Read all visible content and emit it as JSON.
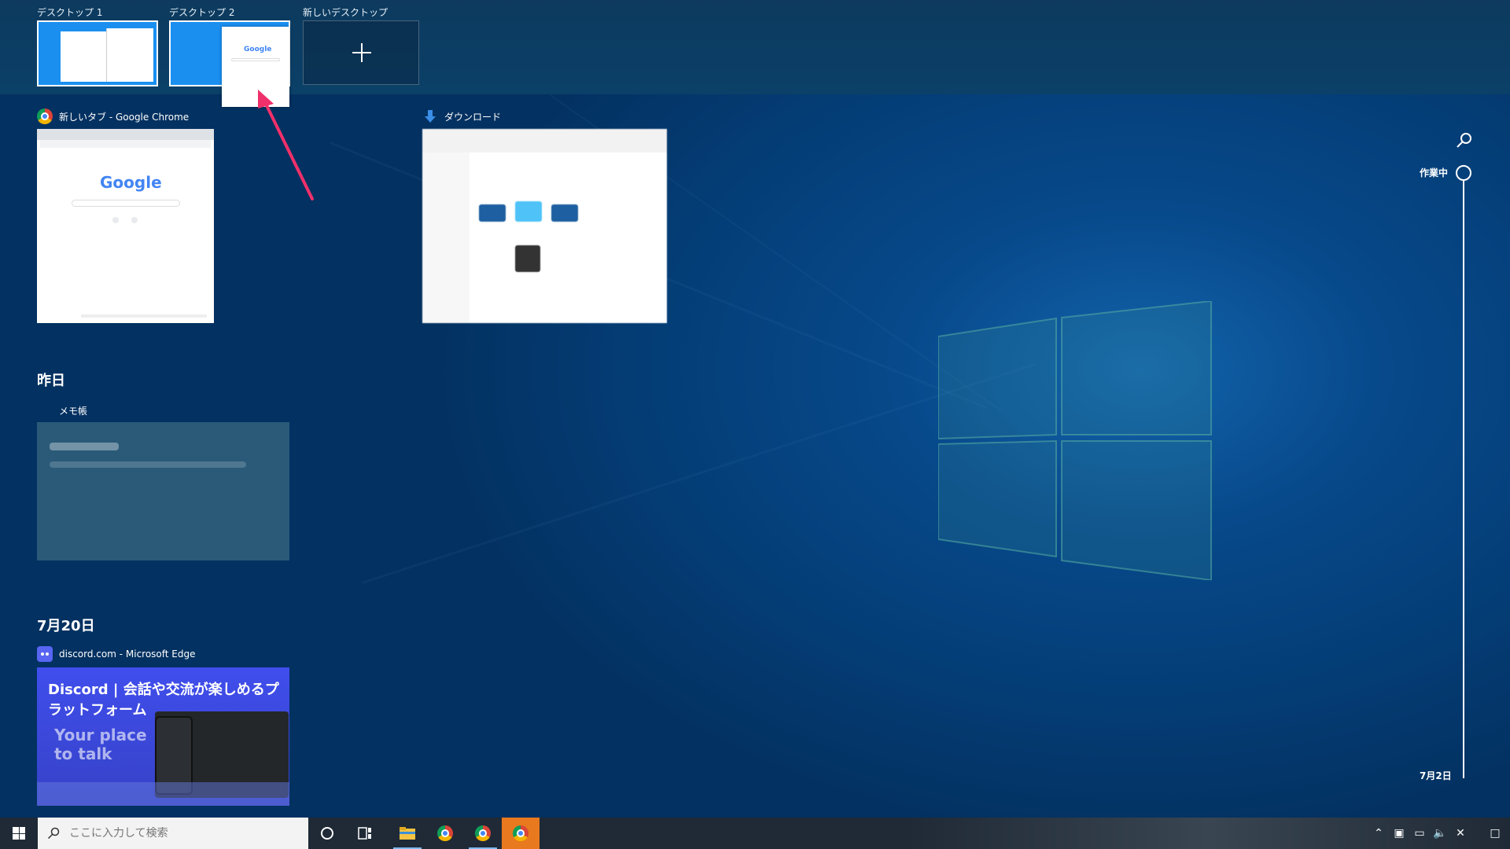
{
  "desktops": {
    "items": [
      {
        "label": "デスクトップ 1"
      },
      {
        "label": "デスクトップ 2"
      }
    ],
    "new_label": "新しいデスクトップ"
  },
  "windows": {
    "chrome": {
      "title": "新しいタブ - Google Chrome",
      "logo": "Google"
    },
    "downloads": {
      "title": "ダウンロード"
    }
  },
  "sections": {
    "yesterday": {
      "heading": "昨日",
      "app_title": "メモ帳"
    },
    "july20": {
      "heading": "7月20日",
      "app_title": "discord.com - Microsoft Edge",
      "headline": "Discord | 会話や交流が楽しめるプラットフォーム",
      "tagline1": "Your place",
      "tagline2": "to talk"
    }
  },
  "timeline": {
    "current_label": "作業中",
    "bottom_label": "7月2日"
  },
  "taskbar": {
    "search_placeholder": "ここに入力して検索"
  },
  "colors": {
    "accent": "#e8791e",
    "taskbar": "#1f2a36",
    "desk_bar": "#0d3a5e"
  }
}
